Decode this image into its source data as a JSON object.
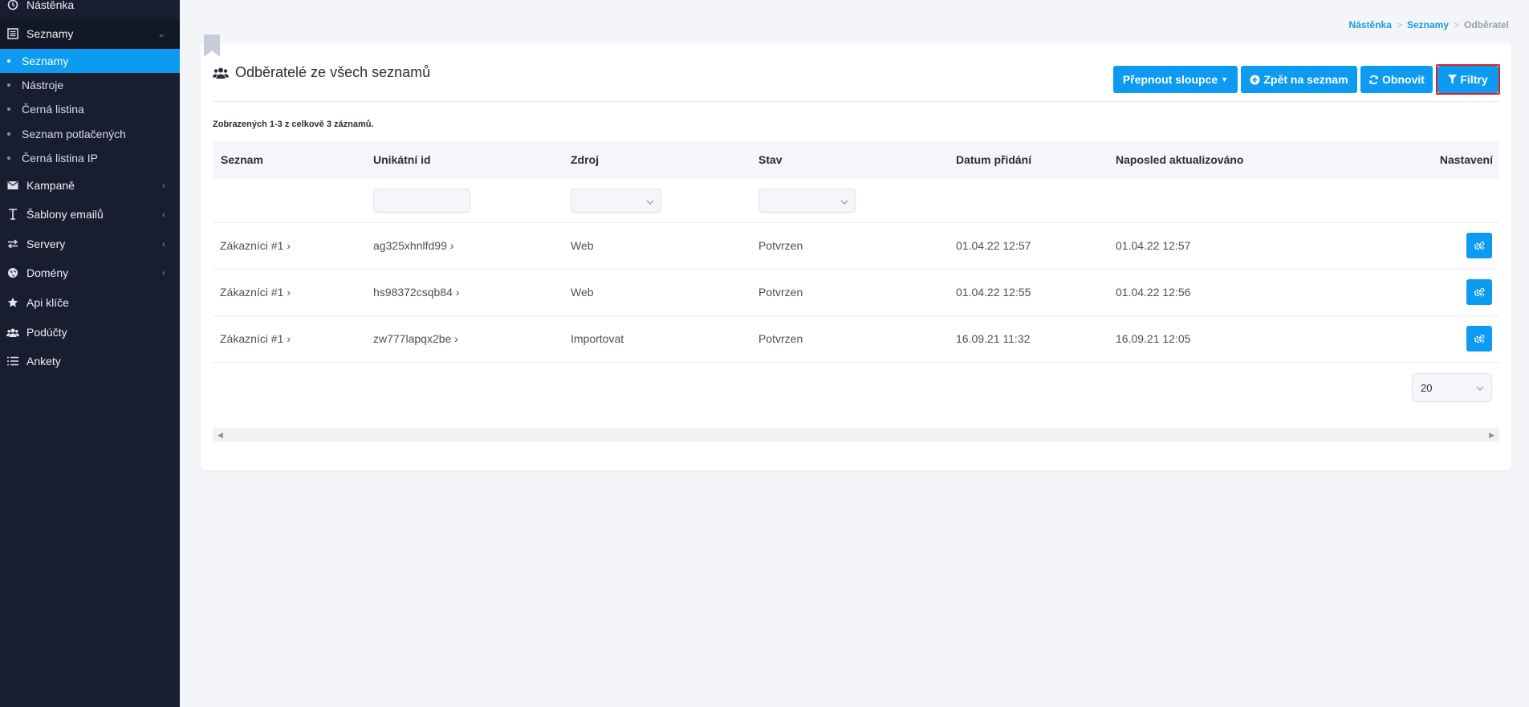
{
  "sidebar": {
    "items": [
      {
        "label": "Nástěnka",
        "icon": "clock-icon"
      },
      {
        "label": "Seznamy",
        "icon": "list-box-icon"
      },
      {
        "label": "Kampaně",
        "icon": "envelope-icon"
      },
      {
        "label": "Šablony emailů",
        "icon": "text-cursor-icon"
      },
      {
        "label": "Servery",
        "icon": "exchange-icon"
      },
      {
        "label": "Domény",
        "icon": "globe-icon"
      },
      {
        "label": "Api klíče",
        "icon": "star-icon"
      },
      {
        "label": "Podúčty",
        "icon": "users-icon"
      },
      {
        "label": "Ankety",
        "icon": "list-icon"
      }
    ],
    "subitems": [
      "Seznamy",
      "Nástroje",
      "Černá listina",
      "Seznam potlačených",
      "Černá listina IP"
    ]
  },
  "breadcrumb": {
    "home": "Nástěnka",
    "lists": "Seznamy",
    "current": "Odběratel",
    "sep": ">"
  },
  "page": {
    "title": "Odběratelé ze všech seznamů",
    "summary": "Zobrazených 1-3 z celkově 3 záznamů."
  },
  "toolbar": {
    "toggle_columns": "Přepnout sloupce",
    "back": "Zpět na seznam",
    "refresh": "Obnovit",
    "filters": "Filtry"
  },
  "table": {
    "columns": [
      "Seznam",
      "Unikátní id",
      "Zdroj",
      "Stav",
      "Datum přidání",
      "Naposled aktualizováno",
      "Nastavení"
    ],
    "rows": [
      {
        "list": "Zákazníci #1",
        "uid": "ag325xhnlfd99",
        "source": "Web",
        "status": "Potvrzen",
        "added": "01.04.22 12:57",
        "updated": "01.04.22 12:57"
      },
      {
        "list": "Zákazníci #1",
        "uid": "hs98372csqb84",
        "source": "Web",
        "status": "Potvrzen",
        "added": "01.04.22 12:55",
        "updated": "01.04.22 12:56"
      },
      {
        "list": "Zákazníci #1",
        "uid": "zw777lapqx2be",
        "source": "Importovat",
        "status": "Potvrzen",
        "added": "16.09.21 11:32",
        "updated": "16.09.21 12:05"
      }
    ]
  },
  "pagination": {
    "page_size": "20"
  },
  "colors": {
    "accent": "#0d9bf2",
    "sidebar_bg": "#181e30",
    "highlight": "#e02020"
  }
}
